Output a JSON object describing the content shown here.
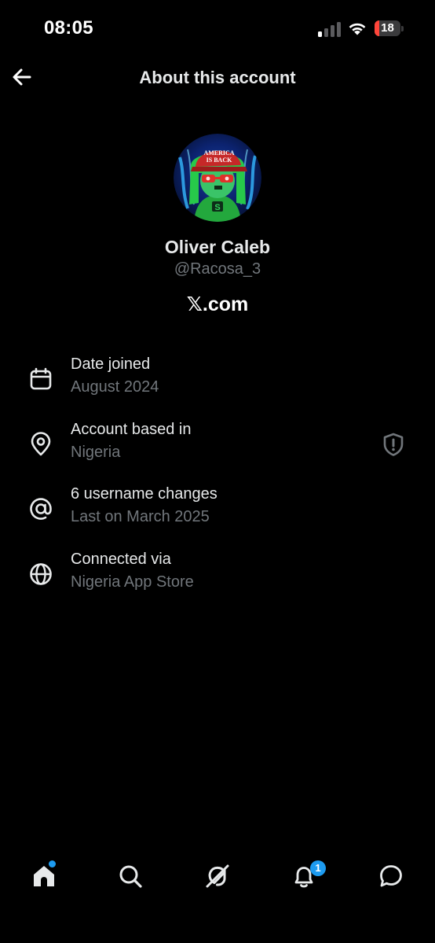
{
  "status_bar": {
    "time": "08:05",
    "battery_level": "18",
    "battery_fraction": 0.18,
    "battery_color": "#ff453a"
  },
  "header": {
    "title": "About this account",
    "back_icon": "arrow-left-icon"
  },
  "profile": {
    "name": "Oliver Caleb",
    "handle": "@Racosa_3",
    "site": "𝕏.com",
    "avatar_text": [
      "AMERICA",
      "IS BACK"
    ]
  },
  "info": [
    {
      "icon": "calendar-icon",
      "title": "Date joined",
      "value": "August 2024"
    },
    {
      "icon": "location-pin-icon",
      "title": "Account based in",
      "value": "Nigeria",
      "trailing_icon": "shield-alert-icon"
    },
    {
      "icon": "at-sign-icon",
      "title": "6 username changes",
      "value": "Last on March 2025"
    },
    {
      "icon": "globe-icon",
      "title": "Connected via",
      "value": "Nigeria App Store"
    }
  ],
  "bottom_nav": {
    "items": [
      "home-icon",
      "search-icon",
      "grok-icon",
      "notifications-icon",
      "messages-icon"
    ],
    "notifications_badge": "1"
  },
  "colors": {
    "background": "#000000",
    "primary_text": "#e7e9ea",
    "secondary_text": "#71767b",
    "accent": "#1d9bf0"
  }
}
